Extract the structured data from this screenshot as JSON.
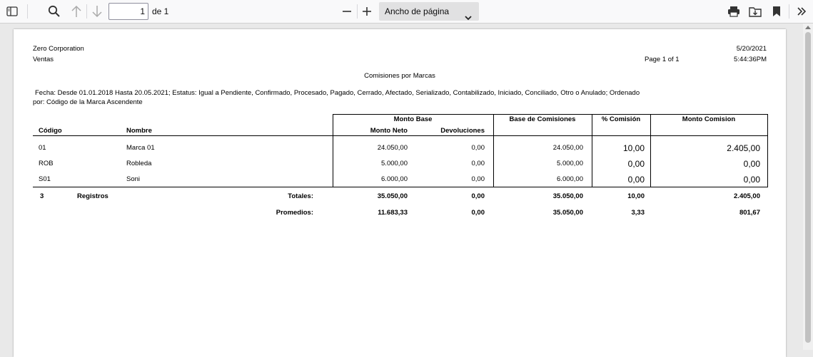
{
  "toolbar": {
    "page_number": "1",
    "page_of": "de 1",
    "zoom_label": "Ancho de página"
  },
  "report": {
    "company": "Zero Corporation",
    "module": "Ventas",
    "date": "5/20/2021",
    "time": "5:44:36PM",
    "page_info": "Page 1 of 1",
    "title": "Comisiones por Marcas",
    "filter_line1": "Fecha: Desde 01.01.2018  Hasta 20.05.2021; Estatus: Igual a Pendiente, Confirmado, Procesado, Pagado, Cerrado, Afectado, Serializado, Contabilizado, Iniciado, Conciliado, Otro o Anulado; Ordenado",
    "filter_line2": "por: Código de la Marca Ascendente",
    "headers": {
      "codigo": "Código",
      "nombre": "Nombre",
      "monto_base": "Monto Base",
      "monto_neto": "Monto Neto",
      "devoluciones": "Devoluciones",
      "base_comisiones": "Base de Comisiones",
      "pct_comision": "% Comisión",
      "monto_comision": "Monto Comision"
    },
    "rows": [
      {
        "codigo": "01",
        "nombre": "Marca 01",
        "monto_neto": "24.050,00",
        "devoluciones": "0,00",
        "base": "24.050,00",
        "pct": "10,00",
        "comision": "2.405,00"
      },
      {
        "codigo": "ROB",
        "nombre": "Robleda",
        "monto_neto": "5.000,00",
        "devoluciones": "0,00",
        "base": "5.000,00",
        "pct": "0,00",
        "comision": "0,00"
      },
      {
        "codigo": "S01",
        "nombre": "Soni",
        "monto_neto": "6.000,00",
        "devoluciones": "0,00",
        "base": "6.000,00",
        "pct": "0,00",
        "comision": "0,00"
      }
    ],
    "totals": {
      "count": "3",
      "registros_label": "Registros",
      "label": "Totales:",
      "monto_neto": "35.050,00",
      "devoluciones": "0,00",
      "base": "35.050,00",
      "pct": "10,00",
      "comision": "2.405,00"
    },
    "averages": {
      "label": "Promedios:",
      "monto_neto": "11.683,33",
      "devoluciones": "0,00",
      "base": "35.050,00",
      "pct": "3,33",
      "comision": "801,67"
    }
  }
}
